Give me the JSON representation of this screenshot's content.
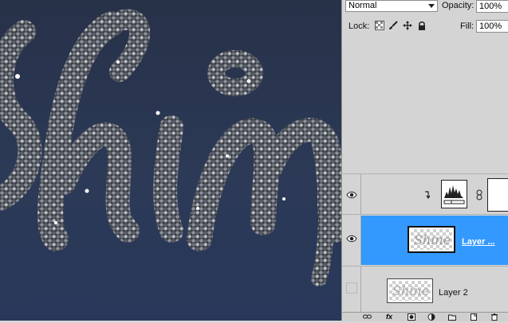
{
  "layers_panel": {
    "blend_mode": "Normal",
    "opacity_label": "Opacity:",
    "opacity_value": "100%",
    "lock_label": "Lock:",
    "fill_label": "Fill:",
    "fill_value": "100%",
    "layers": [
      {
        "name": "",
        "type": "adjustment-levels",
        "visible": true,
        "selected": false,
        "clipped": true
      },
      {
        "name": "Layer ...",
        "type": "pixel",
        "visible": true,
        "selected": true
      },
      {
        "name": "Layer 2",
        "type": "pixel",
        "visible": false,
        "selected": false
      }
    ]
  },
  "colors": {
    "selected_row": "#3399ff",
    "canvas_bg": "#29355a",
    "panel_bg": "#d4d4d4"
  },
  "icons": [
    "transparency-lock-icon",
    "brush-lock-icon",
    "move-lock-icon",
    "all-lock-icon",
    "eye-icon",
    "clip-arrow-icon",
    "levels-icon",
    "link-icon",
    "link-layers-icon",
    "fx-icon",
    "mask-icon",
    "adjustment-icon",
    "folder-icon",
    "new-layer-icon",
    "trash-icon"
  ]
}
